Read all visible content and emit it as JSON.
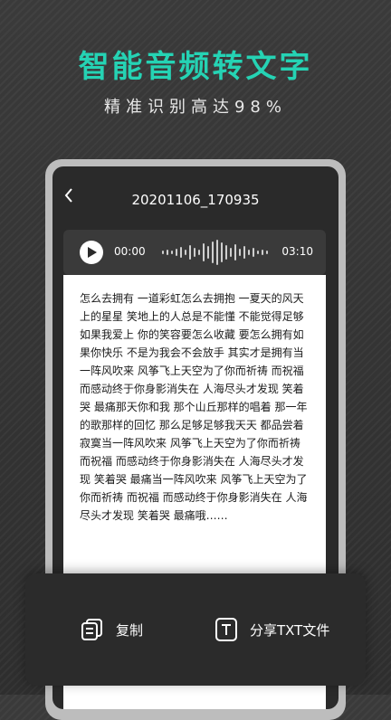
{
  "promo": {
    "headline": "智能音频转文字",
    "subline": "精准识别高达98%"
  },
  "screen": {
    "title": "20201106_170935",
    "player": {
      "current_time": "00:00",
      "total_time": "03:10"
    },
    "transcript": "怎么去拥有 一道彩虹怎么去拥抱 一夏天的风天上的星星 笑地上的人总是不能懂 不能觉得足够如果我爱上 你的笑容要怎么收藏 要怎么拥有如果你快乐 不是为我会不会放手 其实才是拥有当一阵风吹来 风筝飞上天空为了你而祈祷 而祝福 而感动终于你身影消失在 人海尽头才发现 笑着哭 最痛那天你和我 那个山丘那样的唱着 那一年的歌那样的回忆 那么足够足够我天天 都品尝着寂寞当一阵风吹来 风筝飞上天空为了你而祈祷 而祝福 而感动终于你身影消失在 人海尽头才发现 笑着哭 最痛当一阵风吹来 风筝飞上天空为了你而祈祷 而祝福 而感动终于你身影消失在 人海尽头才发现 笑着哭 最痛哦……"
  },
  "actions": {
    "copy_label": "复制",
    "share_label": "分享TXT文件"
  },
  "icons": {
    "back": "chevron-left-icon",
    "play": "play-icon",
    "waveform": "waveform-icon",
    "copy": "copy-icon",
    "text_file": "text-file-icon"
  },
  "colors": {
    "accent": "#25d3b4",
    "background": "#333333",
    "panel": "#2b2b2b"
  }
}
